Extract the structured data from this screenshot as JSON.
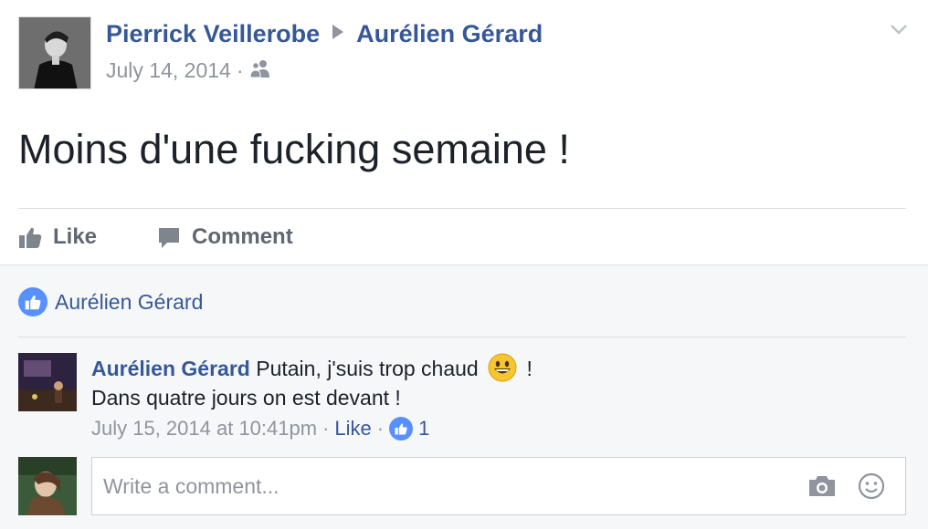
{
  "post": {
    "author": "Pierrick Veillerobe",
    "target": "Aurélien Gérard",
    "date": "July 14, 2014",
    "meta_separator": "·",
    "privacy_icon": "friends-icon",
    "text": "Moins d'une fucking semaine !"
  },
  "actions": {
    "like_label": "Like",
    "comment_label": "Comment"
  },
  "likes": {
    "names": "Aurélien Gérard"
  },
  "comments": [
    {
      "author": "Aurélien Gérard",
      "text_line1": "Putain, j'suis trop chaud",
      "emoji": "grinning-face",
      "text_line1_end": "!",
      "text_line2": "Dans quatre jours on est devant !",
      "timestamp": "July 15, 2014 at 10:41pm",
      "separator": "·",
      "like_label": "Like",
      "like_count": "1"
    }
  ],
  "compose": {
    "placeholder": "Write a comment...",
    "camera_icon": "camera-icon",
    "emoji_icon": "smiley-icon"
  },
  "colors": {
    "link": "#365899",
    "muted": "#90949c",
    "like_blue": "#5890ff"
  }
}
